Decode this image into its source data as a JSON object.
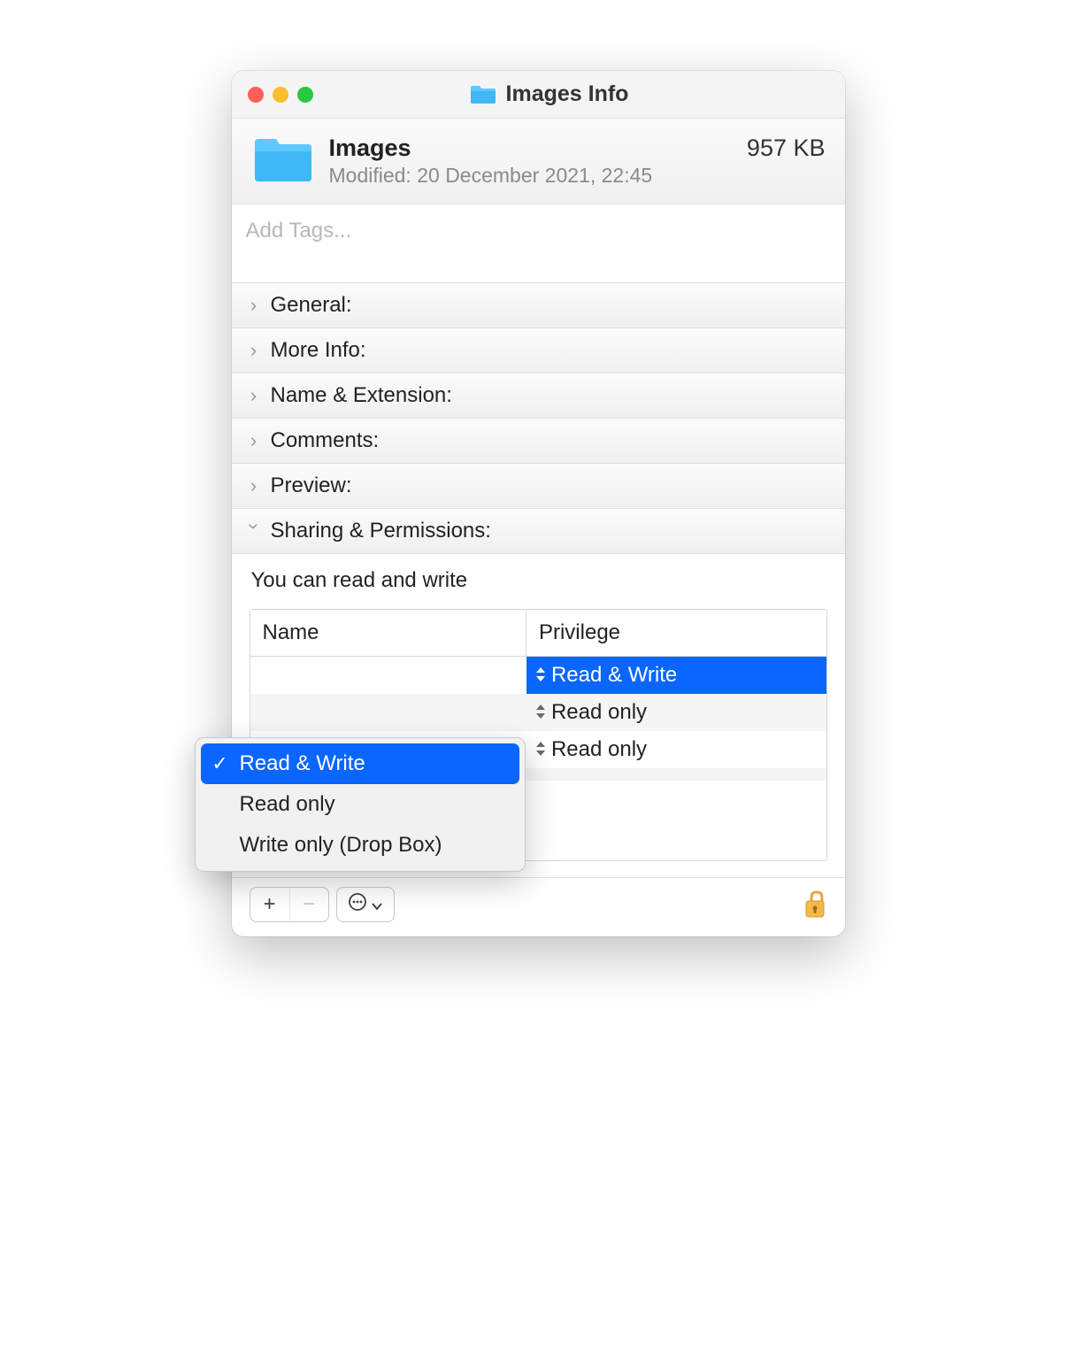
{
  "window": {
    "title": "Images Info"
  },
  "header": {
    "name": "Images",
    "modified": "Modified: 20 December 2021, 22:45",
    "size": "957 KB"
  },
  "tags": {
    "placeholder": "Add Tags..."
  },
  "sections": [
    {
      "label": "General:"
    },
    {
      "label": "More Info:"
    },
    {
      "label": "Name & Extension:"
    },
    {
      "label": "Comments:"
    },
    {
      "label": "Preview:"
    },
    {
      "label": "Sharing & Permissions:"
    }
  ],
  "permissions": {
    "summary": "You can read and write",
    "columns": {
      "name": "Name",
      "privilege": "Privilege"
    },
    "rows": [
      {
        "privilege": "Read & Write",
        "selected": true
      },
      {
        "privilege": "Read only",
        "selected": false
      },
      {
        "privilege": "Read only",
        "selected": false
      }
    ]
  },
  "dropdown": {
    "items": [
      {
        "label": "Read & Write",
        "checked": true
      },
      {
        "label": "Read only",
        "checked": false
      },
      {
        "label": "Write only (Drop Box)",
        "checked": false
      }
    ]
  }
}
